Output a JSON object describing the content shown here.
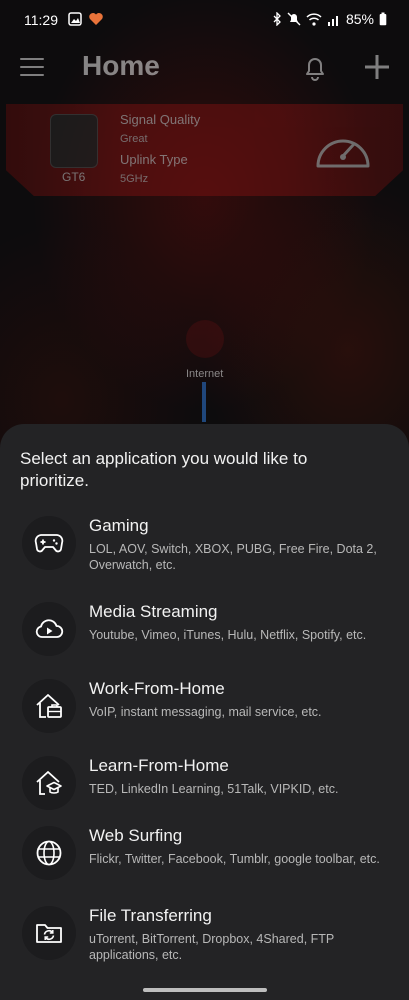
{
  "status_bar": {
    "time": "11:29",
    "battery": "85%"
  },
  "header": {
    "title": "Home"
  },
  "router": {
    "name": "GT6",
    "signal_label": "Signal Quality",
    "signal_value": "Great",
    "uplink_label": "Uplink Type",
    "uplink_value": "5GHz"
  },
  "internet_label": "Internet",
  "sheet": {
    "title": "Select an application you would like to prioritize.",
    "items": [
      {
        "name": "Gaming",
        "desc": "LOL, AOV, Switch, XBOX, PUBG, Free Fire, Dota 2, Overwatch, etc.",
        "icon": "gamepad-icon"
      },
      {
        "name": "Media Streaming",
        "desc": "Youtube, Vimeo, iTunes, Hulu, Netflix, Spotify, etc.",
        "icon": "cloud-play-icon"
      },
      {
        "name": "Work-From-Home",
        "desc": "VoIP, instant messaging, mail service, etc.",
        "icon": "home-briefcase-icon"
      },
      {
        "name": "Learn-From-Home",
        "desc": "TED, LinkedIn Learning, 51Talk, VIPKID, etc.",
        "icon": "home-graduation-icon"
      },
      {
        "name": "Web Surfing",
        "desc": "Flickr, Twitter, Facebook, Tumblr, google toolbar, etc.",
        "icon": "globe-icon"
      },
      {
        "name": "File Transferring",
        "desc": "uTorrent, BitTorrent, Dropbox, 4Shared, FTP applications, etc.",
        "icon": "folder-sync-icon"
      }
    ]
  },
  "colors": {
    "sheet_bg": "#232325",
    "accent_red": "#7b1111",
    "link_blue": "#2b6fc4"
  }
}
